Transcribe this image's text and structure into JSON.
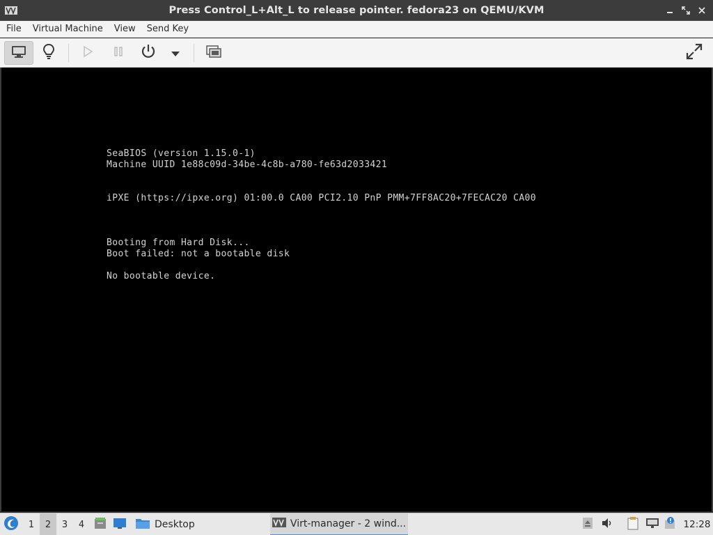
{
  "window": {
    "title": "Press Control_L+Alt_L to release pointer. fedora23 on QEMU/KVM",
    "app_icon": "virt-manager-icon",
    "controls": [
      "minimize-icon",
      "maximize-icon",
      "close-icon"
    ]
  },
  "menubar": {
    "items": [
      "File",
      "Virtual Machine",
      "View",
      "Send Key"
    ]
  },
  "toolbar": {
    "buttons": [
      {
        "name": "console-view",
        "icon": "monitor-icon",
        "active": true
      },
      {
        "name": "details-view",
        "icon": "lightbulb-icon"
      },
      {
        "name": "run",
        "icon": "play-icon",
        "enabled": false
      },
      {
        "name": "pause",
        "icon": "pause-icon",
        "enabled": false
      },
      {
        "name": "shutdown",
        "icon": "power-icon"
      },
      {
        "name": "shutdown-menu",
        "icon": "dropdown-arrow-icon"
      },
      {
        "name": "snapshots",
        "icon": "snapshots-icon"
      },
      {
        "name": "fullscreen",
        "icon": "fullscreen-icon"
      }
    ]
  },
  "console": {
    "lines": [
      "SeaBIOS (version 1.15.0-1)",
      "Machine UUID 1e88c09d-34be-4c8b-a780-fe63d2033421",
      "iPXE (https://ipxe.org) 01:00.0 CA00 PCI2.10 PnP PMM+7FF8AC20+7FECAC20 CA00",
      "Booting from Hard Disk...",
      "Boot failed: not a bootable disk",
      "No bootable device."
    ]
  },
  "taskbar": {
    "start_icon": "lxqt-menu-icon",
    "workspaces": [
      "1",
      "2",
      "3",
      "4"
    ],
    "active_workspace": "2",
    "quicklaunch": [
      "file-manager-icon",
      "show-desktop-icon"
    ],
    "tasks": [
      {
        "label": "Desktop",
        "icon": "folder-icon"
      },
      {
        "label": "Virt-manager - 2 wind...",
        "icon": "virt-manager-icon",
        "current": true
      }
    ],
    "tray": [
      "eject-icon",
      "volume-icon",
      "clipboard-icon",
      "network-icon",
      "update-icon"
    ],
    "clock": "12:28"
  },
  "colors": {
    "titlebar_bg": "#3c3c3c",
    "console_bg": "#000000",
    "console_text": "#d4d4d4",
    "taskbar_bg": "#e8e8e8",
    "accent": "#4a90d9"
  }
}
